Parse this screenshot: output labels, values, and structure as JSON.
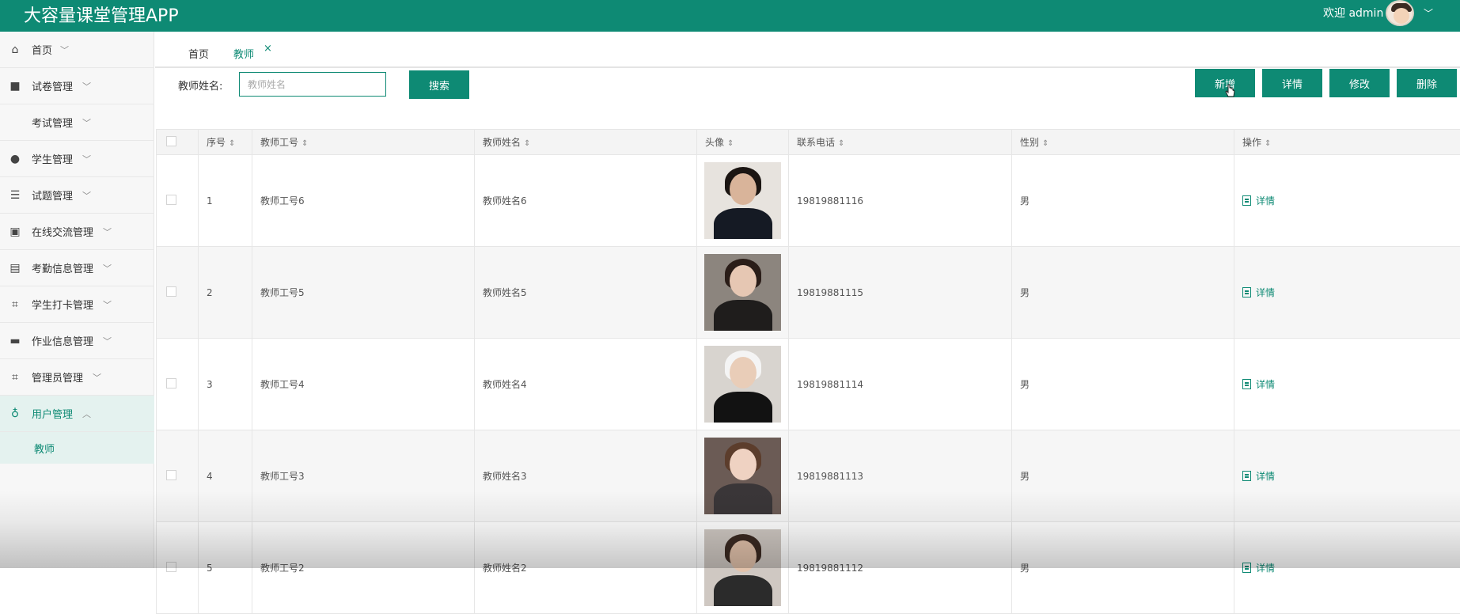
{
  "header": {
    "app_title": "大容量课堂管理APP",
    "welcome_text": "欢迎 admin",
    "accent": "#0e8a74"
  },
  "sidebar": {
    "items": [
      {
        "label": "首页",
        "icon": "home-icon",
        "caret": "﹀"
      },
      {
        "label": "试卷管理",
        "icon": "gift-icon",
        "caret": "﹀"
      },
      {
        "label": "考试管理",
        "icon": "",
        "caret": "﹀"
      },
      {
        "label": "学生管理",
        "icon": "user-icon",
        "caret": "﹀"
      },
      {
        "label": "试题管理",
        "icon": "list-icon",
        "caret": "﹀"
      },
      {
        "label": "在线交流管理",
        "icon": "chip-icon",
        "caret": "﹀"
      },
      {
        "label": "考勤信息管理",
        "icon": "briefcase-icon",
        "caret": "﹀"
      },
      {
        "label": "学生打卡管理",
        "icon": "crop-icon",
        "caret": "﹀"
      },
      {
        "label": "作业信息管理",
        "icon": "monitor-icon",
        "caret": "﹀"
      },
      {
        "label": "管理员管理",
        "icon": "crop-icon",
        "caret": "﹀"
      },
      {
        "label": "用户管理",
        "icon": "badge-icon",
        "caret": "︿"
      }
    ],
    "sub_item": "教师"
  },
  "tabs": {
    "home": "首页",
    "teacher": "教师",
    "close": "×"
  },
  "search": {
    "label": "教师姓名:",
    "placeholder": "教师姓名",
    "button": "搜索"
  },
  "actions": {
    "add": "新增",
    "detail": "详情",
    "edit": "修改",
    "delete": "删除"
  },
  "table": {
    "sort_glyph": "⇕",
    "columns": [
      "序号",
      "教师工号",
      "教师姓名",
      "头像",
      "联系电话",
      "性别",
      "操作"
    ],
    "rows": [
      {
        "index": "1",
        "job_no": "教师工号6",
        "name": "教师姓名6",
        "phone": "19819881116",
        "gender": "男",
        "op": "详情"
      },
      {
        "index": "2",
        "job_no": "教师工号5",
        "name": "教师姓名5",
        "phone": "19819881115",
        "gender": "男",
        "op": "详情"
      },
      {
        "index": "3",
        "job_no": "教师工号4",
        "name": "教师姓名4",
        "phone": "19819881114",
        "gender": "男",
        "op": "详情"
      },
      {
        "index": "4",
        "job_no": "教师工号3",
        "name": "教师姓名3",
        "phone": "19819881113",
        "gender": "男",
        "op": "详情"
      },
      {
        "index": "5",
        "job_no": "教师工号2",
        "name": "教师姓名2",
        "phone": "19819881112",
        "gender": "男",
        "op": "详情"
      }
    ]
  }
}
